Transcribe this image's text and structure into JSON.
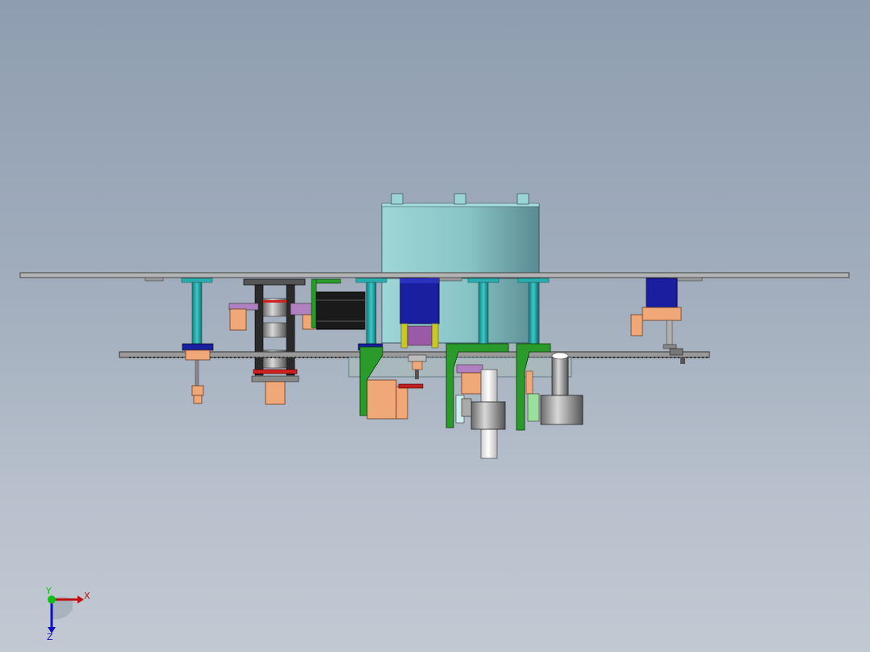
{
  "triad": {
    "x_label": "X",
    "y_label": "Y",
    "z_label": "Z"
  },
  "colors": {
    "background_top": "#8e9db0",
    "background_bottom": "#c2c9d3",
    "tank": "#8fcfcf",
    "post": "#28b0b0",
    "motor": "#1a1fa0",
    "bracket": "#2a9a2a",
    "copper_part": "#f0a878",
    "plate": "#a8a8a8"
  }
}
